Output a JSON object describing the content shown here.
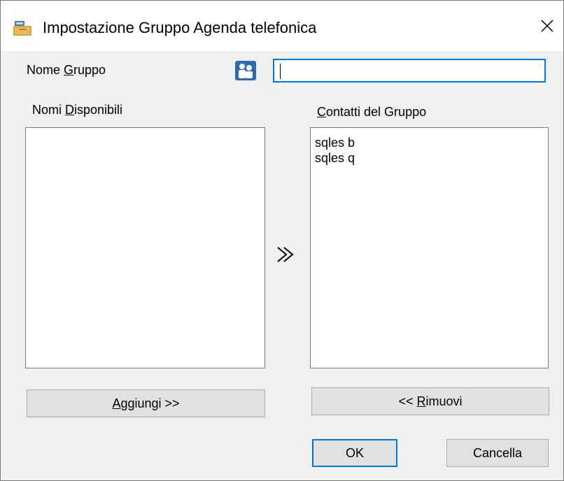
{
  "window": {
    "title": "Impostazione Gruppo Agenda telefonica"
  },
  "group_name": {
    "label_before": "Nome ",
    "label_access": "G",
    "label_after": "ruppo",
    "value": ""
  },
  "available": {
    "label_before": "Nomi ",
    "label_access": "D",
    "label_after": "isponibili",
    "items": []
  },
  "members": {
    "label_access": "C",
    "label_after": "ontatti del Gruppo",
    "items": [
      "sqles b",
      "sqles q"
    ]
  },
  "buttons": {
    "add_access": "A",
    "add_after": "ggiungi >>",
    "remove_before": "<< ",
    "remove_access": "R",
    "remove_after": "imuovi",
    "ok": "OK",
    "cancel": "Cancella"
  },
  "icons": {
    "app": "address-book-icon",
    "group": "group-people-icon",
    "move": "double-chevron-right-icon",
    "close": "close-icon"
  },
  "colors": {
    "focus_border": "#0078d7",
    "dialog_background": "#f0f0f0",
    "button_face": "#e1e1e1"
  }
}
